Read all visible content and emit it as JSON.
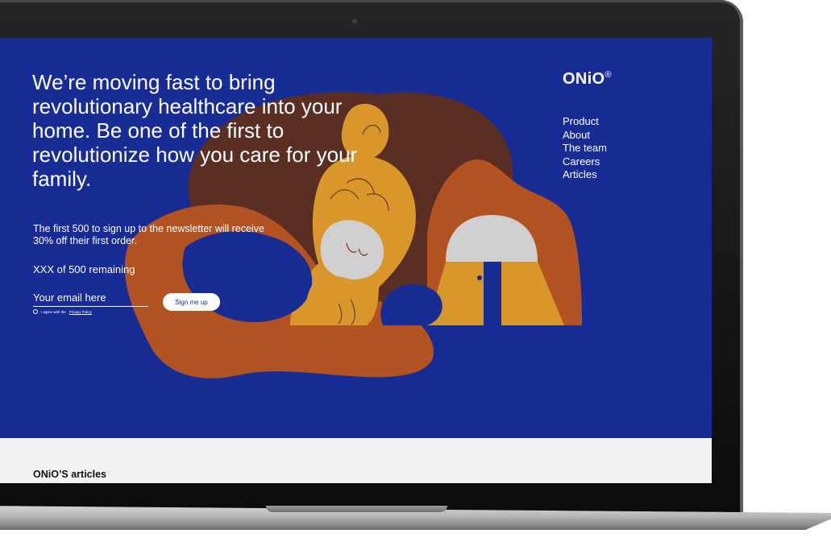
{
  "hero": {
    "headline": "We’re moving fast to bring revolutionary healthcare into your home. Be one of the first to revolutionize how you care for your family.",
    "promo": "The first 500 to sign up to the newsletter will receive 30% off their first order.",
    "remaining": "XXX of 500 remaining",
    "email_placeholder": "Your email here",
    "agree_text": "I agree with the",
    "policy_link": "Privacy Policy",
    "signup_label": "Sign me up"
  },
  "brand": {
    "logo": "ONiO",
    "registered": "®"
  },
  "nav": {
    "items": [
      "Product",
      "About",
      "The team",
      "Careers",
      "Articles"
    ]
  },
  "articles": {
    "title": "ONiO’S articles"
  },
  "colors": {
    "hero_bg": "#182c95",
    "orange": "#b35322",
    "mustard": "#d9962b",
    "brown": "#5a2e22",
    "gray": "#cfcfcf",
    "strip_bg": "#f2f2f2"
  }
}
